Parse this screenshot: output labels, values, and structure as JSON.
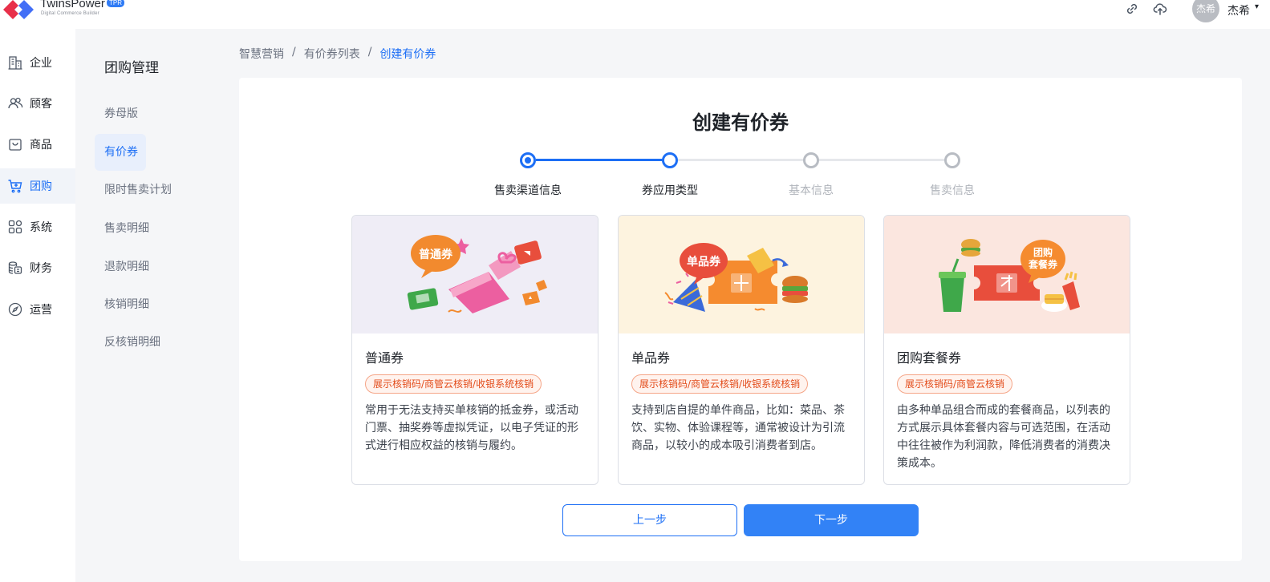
{
  "brand": {
    "name": "TwinsPower",
    "badge": "TPR",
    "tagline": "Digital Commerce Builder"
  },
  "topbar": {
    "icons": [
      "link-icon",
      "cloud-upload-icon"
    ],
    "avatar_text": "杰希",
    "username": "杰希",
    "caret": "▾"
  },
  "nav": {
    "items": [
      {
        "label": "企业",
        "icon": "building-icon"
      },
      {
        "label": "顾客",
        "icon": "users-icon"
      },
      {
        "label": "商品",
        "icon": "shopping-bag-icon"
      },
      {
        "label": "团购",
        "icon": "cart-icon",
        "active": true
      },
      {
        "label": "系统",
        "icon": "apps-grid-icon"
      },
      {
        "label": "财务",
        "icon": "coins-icon"
      },
      {
        "label": "运营",
        "icon": "compass-icon"
      }
    ]
  },
  "subnav": {
    "title": "团购管理",
    "items": [
      {
        "label": "券母版"
      },
      {
        "label": "有价券",
        "active": true
      },
      {
        "label": "限时售卖计划"
      },
      {
        "label": "售卖明细"
      },
      {
        "label": "退款明细"
      },
      {
        "label": "核销明细"
      },
      {
        "label": "反核销明细"
      }
    ]
  },
  "breadcrumb": {
    "items": [
      "智慧营销",
      "有价券列表",
      "创建有价券"
    ],
    "separator": "/"
  },
  "page": {
    "title": "创建有价券"
  },
  "steps": {
    "items": [
      {
        "label": "售卖渠道信息",
        "status": "done"
      },
      {
        "label": "券应用类型",
        "status": "current"
      },
      {
        "label": "基本信息",
        "status": "pending"
      },
      {
        "label": "售卖信息",
        "status": "pending"
      }
    ]
  },
  "cards": [
    {
      "title": "普通券",
      "illustration_label": "普通券",
      "tag": "展示核销码/商管云核销/收银系统核销",
      "desc": "常用于无法支持买单核销的抵金券，或活动门票、抽奖券等虚拟凭证，以电子凭证的形式进行相应权益的核销与履约。"
    },
    {
      "title": "单品券",
      "illustration_label": "单品券",
      "tag": "展示核销码/商管云核销/收银系统核销",
      "desc": "支持到店自提的单件商品，比如：菜品、茶饮、实物、体验课程等，通常被设计为引流商品，以较小的成本吸引消费者到店。"
    },
    {
      "title": "团购套餐券",
      "illustration_label_1": "团购",
      "illustration_label_2": "套餐券",
      "tag": "展示核销码/商管云核销",
      "desc": "由多种单品组合而成的套餐商品，以列表的方式展示具体套餐内容与可选范围，在活动中往往被作为利润款，降低消费者的消费决策成本。"
    }
  ],
  "actions": {
    "prev": "上一步",
    "next": "下一步"
  },
  "colors": {
    "primary": "#1d6ff5",
    "button_primary": "#3282f6",
    "tag_text": "#e34d1c",
    "card1_bg": "#efedf6",
    "card2_bg": "#fdf3df",
    "card3_bg": "#fbe6df"
  }
}
